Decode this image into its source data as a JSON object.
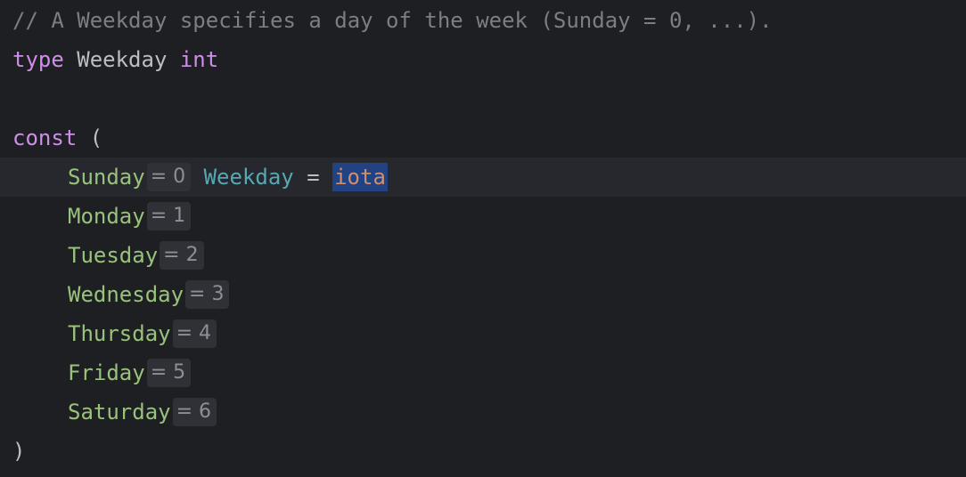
{
  "lines": {
    "comment": {
      "prefix": "// A ",
      "ref1": "Weekday",
      "middle": " specifies a day of the week (",
      "ref2": "Sunday",
      "suffix": " = 0, ...)."
    },
    "type_decl": {
      "keyword": "type",
      "name": " Weekday ",
      "base": "int"
    },
    "const_open": {
      "keyword": "const",
      "paren": " ("
    },
    "first_const": {
      "name": "Sunday",
      "hint": "= 0",
      "type": "Weekday",
      "eq": " = ",
      "value": "iota"
    },
    "consts": [
      {
        "name": "Monday",
        "hint": "= 1"
      },
      {
        "name": "Tuesday",
        "hint": "= 2"
      },
      {
        "name": "Wednesday",
        "hint": "= 3"
      },
      {
        "name": "Thursday",
        "hint": "= 4"
      },
      {
        "name": "Friday",
        "hint": "= 5"
      },
      {
        "name": "Saturday",
        "hint": "= 6"
      }
    ],
    "const_close": ")"
  },
  "colors": {
    "background": "#1e1f22",
    "current_line": "#26282e",
    "keyword": "#cf8ee8",
    "constant": "#99c27c",
    "type_ref": "#56a8b5",
    "builtin": "#cf8e6d",
    "comment": "#7a7e85",
    "selection": "#214283"
  }
}
